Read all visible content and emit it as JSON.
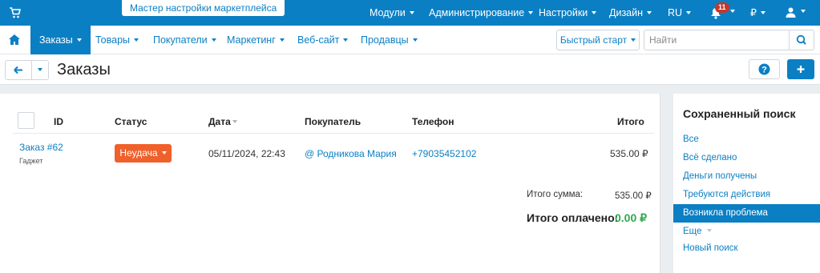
{
  "topbar": {
    "wizard_label": "Мастер настройки маркетплейса",
    "menus": [
      "Модули",
      "Администрирование",
      "Настройки",
      "Дизайн",
      "RU",
      "₽"
    ],
    "notifications_count": "11"
  },
  "nav": {
    "items": [
      "Заказы",
      "Товары",
      "Покупатели",
      "Маркетинг",
      "Веб-сайт",
      "Продавцы"
    ],
    "quickstart_label": "Быстрый старт",
    "search_placeholder": "Найти"
  },
  "page": {
    "title": "Заказы"
  },
  "table": {
    "headers": {
      "id": "ID",
      "status": "Статус",
      "date": "Дата",
      "customer": "Покупатель",
      "phone": "Телефон",
      "total": "Итого"
    },
    "rows": [
      {
        "order": "Заказ #62",
        "vendor": "Гаджет",
        "status": "Неудача",
        "date": "05/11/2024, 22:43",
        "customer": "@ Родникова Мария",
        "phone": "+79035452102",
        "total": "535.00 ₽"
      }
    ]
  },
  "totals": {
    "sum_label": "Итого сумма:",
    "sum_value": "535.00 ₽",
    "paid_label": "Итого оплачено:",
    "paid_value": "0.00 ₽"
  },
  "sidebar": {
    "title": "Сохраненный поиск",
    "items": [
      "Все",
      "Всё сделано",
      "Деньги получены",
      "Требуются действия",
      "Возникла проблема",
      "Еще",
      "Новый поиск"
    ],
    "active_index": 4
  },
  "colors": {
    "primary": "#0b7fc4",
    "danger": "#f0602b",
    "success": "#2fa84f"
  }
}
